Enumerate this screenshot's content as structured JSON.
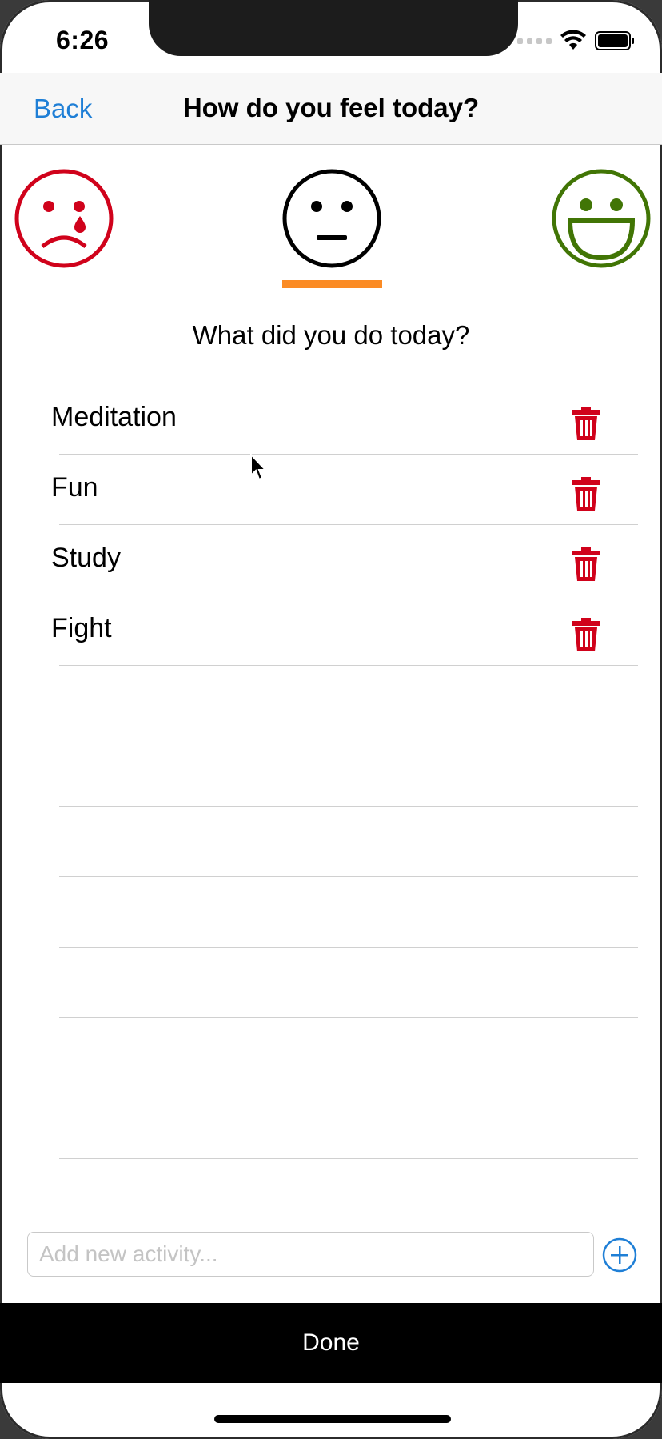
{
  "status_bar": {
    "time": "6:26",
    "icons": [
      "signal-icon",
      "wifi-icon",
      "battery-icon"
    ]
  },
  "navbar": {
    "back_label": "Back",
    "title": "How do you feel today?"
  },
  "moods": {
    "options": [
      {
        "name": "sad",
        "color": "#d0021b"
      },
      {
        "name": "neutral",
        "color": "#000000"
      },
      {
        "name": "happy",
        "color": "#417505"
      }
    ],
    "selected": "neutral",
    "selection_color": "#fb8b24"
  },
  "question": "What did you do today?",
  "activities": [
    {
      "label": "Meditation"
    },
    {
      "label": "Fun"
    },
    {
      "label": "Study"
    },
    {
      "label": "Fight"
    }
  ],
  "trash_color": "#d0021b",
  "add_activity": {
    "placeholder": "Add new activity...",
    "value": ""
  },
  "done_label": "Done"
}
